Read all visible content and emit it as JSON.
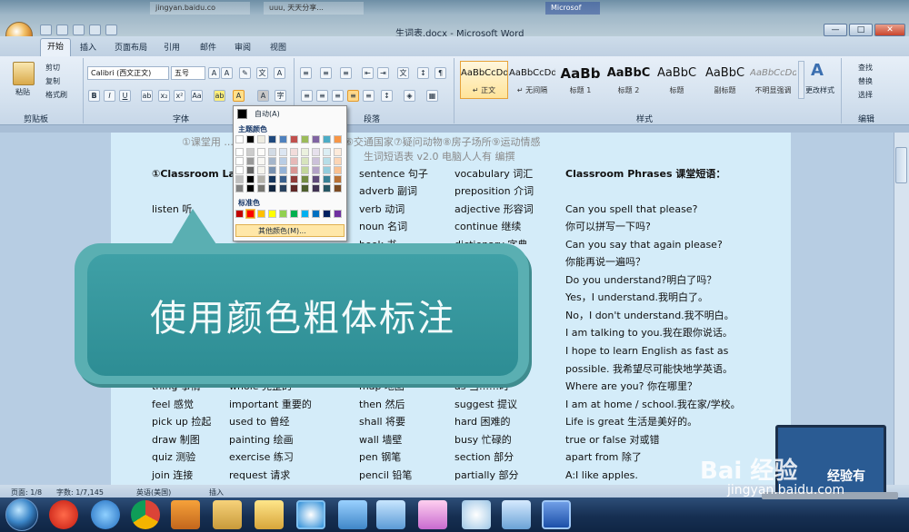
{
  "window": {
    "title": "生词表.docx - Microsoft Word",
    "bg_tabs": [
      "jingyan.baidu.co",
      "uuu, 天天分享...",
      "Microsof"
    ],
    "buttons": {
      "minimize": "—",
      "maximize": "□",
      "close": "✕"
    }
  },
  "ribbon_tabs": [
    "开始",
    "插入",
    "页面布局",
    "引用",
    "邮件",
    "审阅",
    "视图"
  ],
  "clipboard": {
    "paste": "粘贴",
    "cut": "剪切",
    "copy": "复制",
    "format_painter": "格式刷",
    "label": "剪贴板"
  },
  "font": {
    "name": "Calibri (西文正文)",
    "size": "五号",
    "label": "字体"
  },
  "paragraph": {
    "label": "段落"
  },
  "styles": {
    "label": "样式",
    "items": [
      {
        "preview": "AaBbCcDd",
        "name": "↵ 正文"
      },
      {
        "preview": "AaBbCcDd",
        "name": "↵ 无间隔"
      },
      {
        "preview": "AaBb",
        "name": "标题 1"
      },
      {
        "preview": "AaBbC",
        "name": "标题 2"
      },
      {
        "preview": "AaBbC",
        "name": "标题"
      },
      {
        "preview": "AaBbC",
        "name": "副标题"
      },
      {
        "preview": "AaBbCcDd",
        "name": "不明显强调"
      }
    ],
    "change_styles": "更改样式"
  },
  "editing": {
    "find": "查找",
    "replace": "替换",
    "select": "选择",
    "label": "编辑"
  },
  "color_popup": {
    "auto": "自动(A)",
    "theme_heading": "主题颜色",
    "standard_heading": "标准色",
    "other": "其他颜色(M)...",
    "theme_top": [
      "#ffffff",
      "#000000",
      "#eeece1",
      "#1f497d",
      "#4f81bd",
      "#c0504d",
      "#9bbb59",
      "#8064a2",
      "#4bacc6",
      "#f79646"
    ],
    "standard": [
      "#c00000",
      "#ff0000",
      "#ffc000",
      "#ffff00",
      "#92d050",
      "#00b050",
      "#00b0f0",
      "#0070c0",
      "#002060",
      "#7030a0"
    ]
  },
  "document": {
    "header_line1": "①课堂用  ...  字④蔬果食品⑤衣服身体⑥交通国家⑦疑问动物⑧房子场所⑨运动情感",
    "header_line2": "生词短语表 v2.0 电脑人人有  编撰",
    "section_title": "①Classroom Lar",
    "col1": [
      "listen 听",
      "thing 事情",
      "feel 感觉",
      "pick up 捡起",
      "draw 制图",
      "quiz 测验",
      "join 连接"
    ],
    "col2": [
      "whole 完整的",
      "important 重要的",
      "used to 曾经",
      "painting 绘画",
      "exercise  练习",
      "request  请求"
    ],
    "col3": [
      "sentence  句子",
      "adverb  副词",
      "verb  动词",
      "noun  名词",
      "book  书",
      "map  地图",
      "then  然后",
      "shall  将要",
      "wall  墙壁",
      "pen  钢笔",
      "pencil  铅笔"
    ],
    "col4": [
      "vocabulary  词汇",
      "preposition  介词",
      "adjective  形容词",
      "continue  继续",
      "dictionary  字典",
      "as  当……时",
      "suggest  提议",
      "hard  困难的",
      "busy  忙碌的",
      "section  部分",
      "partially  部分"
    ],
    "phrases_title": "Classroom Phrases  课堂短语：",
    "phrases": [
      "Can you spell that please?",
      "你可以拼写一下吗?",
      "Can you say that again please?",
      "你能再说一遍吗？",
      "Do you understand?明白了吗？",
      "Yes，I understand.我明白了。",
      "No，I don't understand.我不明白。",
      "I am talking to you.我在跟你说话。",
      "I  hope  to  learn  English  as  fast  as",
      "possible.  我希望尽可能快地学英语。",
      "Where are you?  你在哪里？",
      "I am at home / school.我在家/学校。",
      "Life is great  生活是美好的。",
      "true or false 对或错",
      "apart from  除了",
      "A:I like apples."
    ]
  },
  "callout": {
    "text": "使用颜色粗体标注"
  },
  "statusbar": {
    "page": "页面: 1/8",
    "words": "字数: 1/7,145",
    "lang": "英语(美国)",
    "mode": "插入"
  },
  "taskbar": {
    "apps": [
      "jiang-app",
      "ie",
      "chrome",
      "media",
      "explorer",
      "notes",
      "network",
      "browser2",
      "paint",
      "fan",
      "display",
      "word"
    ]
  },
  "watermark": {
    "text": "Bai 经验",
    "url": "jingyan.baidu.com",
    "corner": "经验有"
  }
}
